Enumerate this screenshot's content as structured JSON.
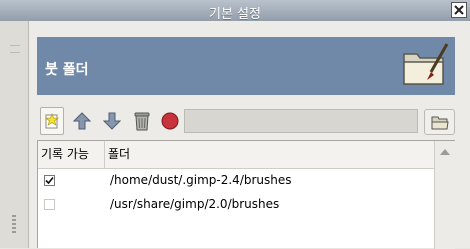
{
  "window": {
    "title": "기본 설정"
  },
  "header": {
    "title": "붓 폴더",
    "icon": "folder-paintbrush-icon"
  },
  "toolbar": {
    "buttons": [
      {
        "name": "new-folder-button",
        "icon": "new-star-icon"
      },
      {
        "name": "move-up-button",
        "icon": "arrow-up-icon"
      },
      {
        "name": "move-down-button",
        "icon": "arrow-down-icon"
      },
      {
        "name": "delete-button",
        "icon": "trash-icon"
      },
      {
        "name": "stop-button",
        "icon": "red-circle-icon"
      }
    ],
    "path_value": "",
    "browse_icon": "folder-open-icon"
  },
  "list": {
    "columns": [
      "기록 가능",
      "폴더"
    ],
    "rows": [
      {
        "writable": true,
        "path": "/home/dust/.gimp-2.4/brushes"
      },
      {
        "writable": false,
        "path": "/usr/share/gimp/2.0/brushes"
      }
    ]
  },
  "colors": {
    "header_bg": "#7189a9",
    "titlebar": "#9aa5b1",
    "stop_red": "#c8323a"
  }
}
